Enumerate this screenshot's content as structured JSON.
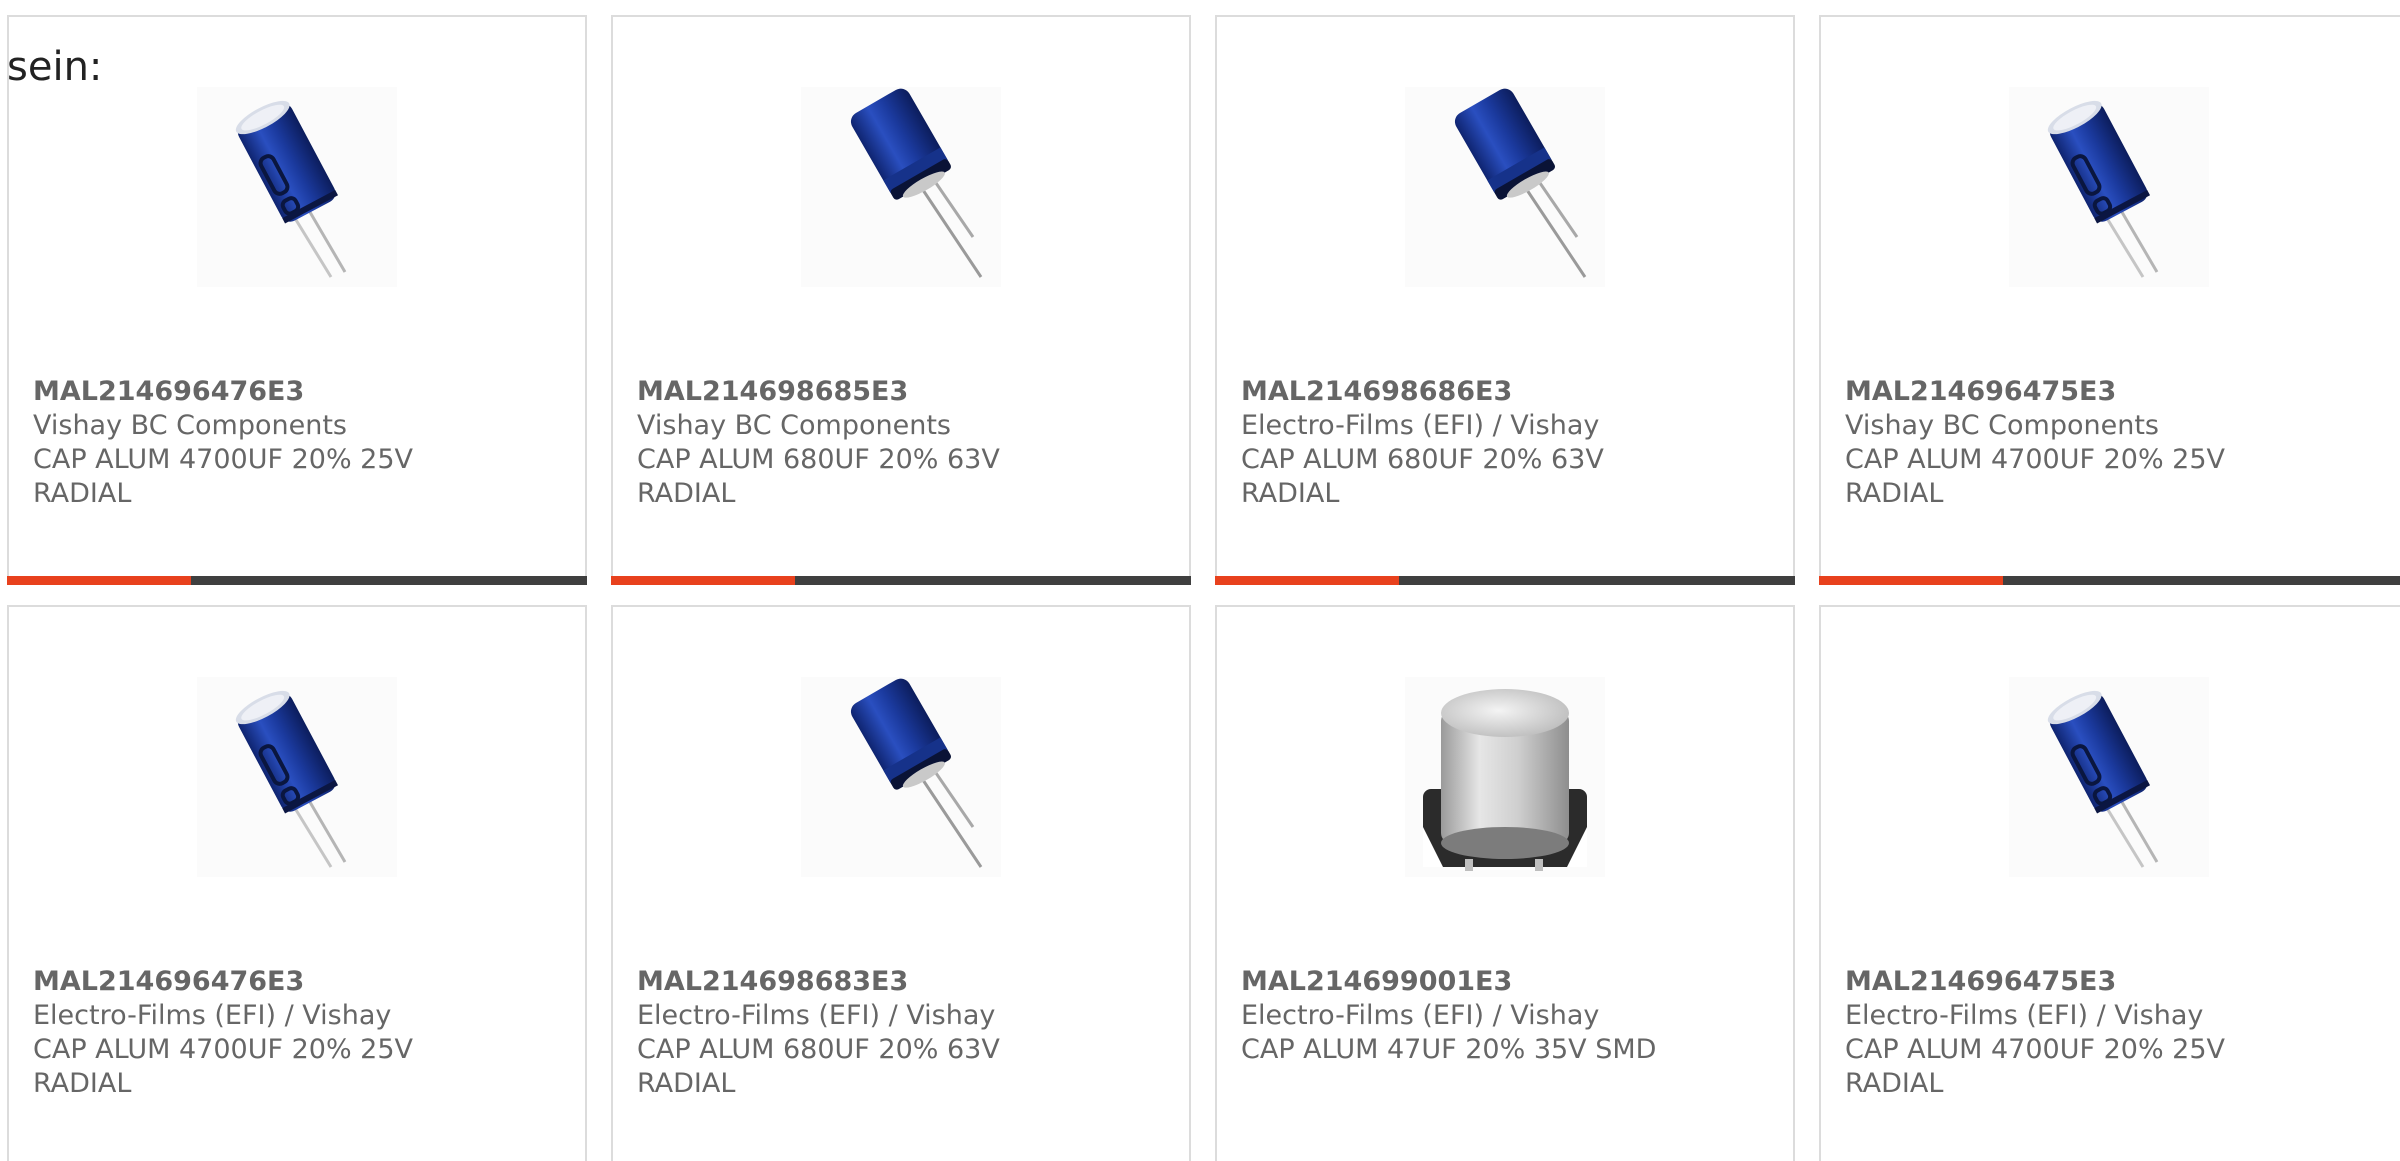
{
  "heading_fragment": "sein:",
  "colors": {
    "card_border": "#dcdcdc",
    "text": "#666666",
    "bar_dark": "#3f3f3f",
    "bar_accent": "#e8411d",
    "capacitor_blue": "#1d3a9e",
    "capacitor_silver": "#c8c8c8"
  },
  "cards": [
    {
      "image": "radial-capacitor-blue-short-leads",
      "part_number": "MAL214696476E3",
      "manufacturer": "Vishay BC Components",
      "description_line1": "CAP ALUM 4700UF 20% 25V",
      "description_line2": "RADIAL"
    },
    {
      "image": "radial-capacitor-blue-long-leads",
      "part_number": "MAL214698685E3",
      "manufacturer": "Vishay BC Components",
      "description_line1": "CAP ALUM 680UF 20% 63V",
      "description_line2": "RADIAL"
    },
    {
      "image": "radial-capacitor-blue-long-leads",
      "part_number": "MAL214698686E3",
      "manufacturer": "Electro-Films (EFI) / Vishay",
      "description_line1": "CAP ALUM 680UF 20% 63V",
      "description_line2": "RADIAL"
    },
    {
      "image": "radial-capacitor-blue-short-leads",
      "part_number": "MAL214696475E3",
      "manufacturer": "Vishay BC Components",
      "description_line1": "CAP ALUM 4700UF 20% 25V",
      "description_line2": "RADIAL"
    },
    {
      "image": "radial-capacitor-blue-short-leads",
      "part_number": "MAL214696476E3",
      "manufacturer": "Electro-Films (EFI) / Vishay",
      "description_line1": "CAP ALUM 4700UF 20% 25V",
      "description_line2": "RADIAL"
    },
    {
      "image": "radial-capacitor-blue-long-leads",
      "part_number": "MAL214698683E3",
      "manufacturer": "Electro-Films (EFI) / Vishay",
      "description_line1": "CAP ALUM 680UF 20% 63V",
      "description_line2": "RADIAL"
    },
    {
      "image": "smd-capacitor-silver-can",
      "part_number": "MAL214699001E3",
      "manufacturer": "Electro-Films (EFI) / Vishay",
      "description_line1": "CAP ALUM 47UF 20% 35V SMD",
      "description_line2": ""
    },
    {
      "image": "radial-capacitor-blue-short-leads",
      "part_number": "MAL214696475E3",
      "manufacturer": "Electro-Films (EFI) / Vishay",
      "description_line1": "CAP ALUM 4700UF 20% 25V",
      "description_line2": "RADIAL"
    }
  ]
}
